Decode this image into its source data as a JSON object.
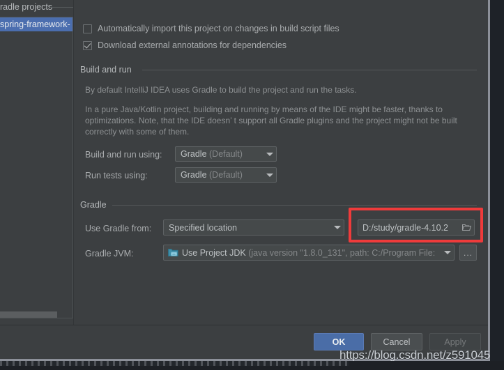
{
  "window": {
    "left_panel": {
      "section_title": "radle projects",
      "selected_item": "spring-framework-"
    },
    "checkboxes": [
      {
        "label": "Automatically import this project on changes in build script files",
        "checked": false
      },
      {
        "label": "Download external annotations for dependencies",
        "checked": true
      }
    ],
    "build_and_run": {
      "group_title": "Build and run",
      "paragraph1": "By default IntelliJ IDEA uses Gradle to build the project and run the tasks.",
      "paragraph2": "In a pure Java/Kotlin project, building and running by means of the IDE might be faster, thanks to optimizations. Note, that the IDE doesn’ t support all Gradle plugins and the project might not be built correctly with some of them.",
      "build_and_run_using": {
        "label": "Build and run using:",
        "value": "Gradle",
        "value_suffix": "(Default)"
      },
      "run_tests_using": {
        "label": "Run tests using:",
        "value": "Gradle",
        "value_suffix": "(Default)"
      }
    },
    "gradle": {
      "group_title": "Gradle",
      "use_gradle_from": {
        "label": "Use Gradle from:",
        "value": "Specified location"
      },
      "gradle_home": {
        "value": "D:/study/gradle-4.10.2"
      },
      "gradle_jvm": {
        "label": "Gradle JVM:",
        "value": "Use Project JDK",
        "value_suffix": "(java version \"1.8.0_131\", path: C:/Program File:",
        "browse_label": "..."
      }
    },
    "buttons": {
      "ok": "OK",
      "cancel": "Cancel",
      "apply": "Apply"
    }
  },
  "overlay": {
    "highlight_color": "#ef3b3b",
    "watermark": "https://blog.csdn.net/z591045"
  }
}
